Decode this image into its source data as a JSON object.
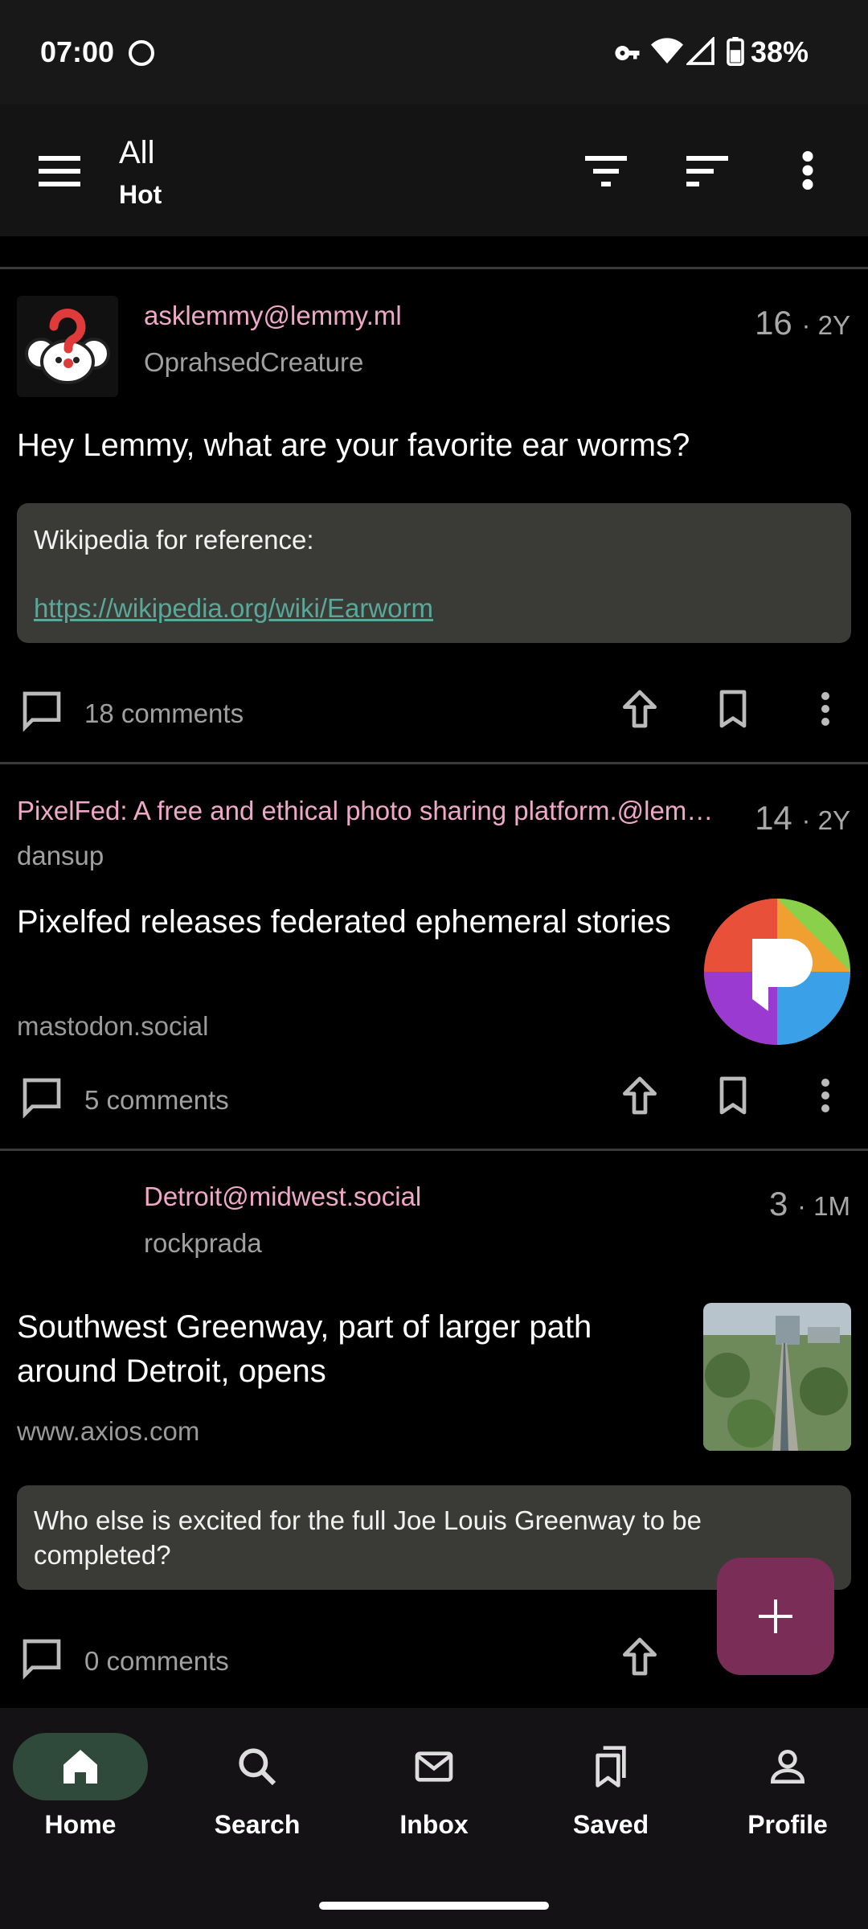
{
  "status_bar": {
    "time": "07:00",
    "battery": "38%"
  },
  "header": {
    "title": "All",
    "subtitle": "Hot"
  },
  "posts": [
    {
      "community": "asklemmy@lemmy.ml",
      "author": "OprahsedCreature",
      "score": "16",
      "age": "· 2Y",
      "title": "Hey Lemmy, what are your favorite ear worms?",
      "body_text": "Wikipedia for reference:",
      "body_link": "https://wikipedia.org/wiki/Earworm",
      "comments": "18 comments"
    },
    {
      "community": "PixelFed: A free and ethical photo sharing platform.@lem…",
      "author": "dansup",
      "score": "14",
      "age": "· 2Y",
      "title": "Pixelfed releases federated ephemeral stories",
      "domain": "mastodon.social",
      "comments": "5 comments"
    },
    {
      "community": "Detroit@midwest.social",
      "author": "rockprada",
      "score": "3",
      "age": "· 1M",
      "title": "Southwest Greenway, part of larger path around Detroit, opens",
      "domain": "www.axios.com",
      "body_text": "Who else is excited for the full Joe Louis Greenway to be completed?",
      "comments": "0 comments"
    }
  ],
  "bottom_nav": [
    {
      "label": "Home"
    },
    {
      "label": "Search"
    },
    {
      "label": "Inbox"
    },
    {
      "label": "Saved"
    },
    {
      "label": "Profile"
    }
  ],
  "colors": {
    "accent_pink": "#f0a8c8",
    "fab": "#7a2d56",
    "home_pill": "#2f4a3a",
    "link": "#5aa899"
  },
  "icons": [
    "menu-icon",
    "filter-icon",
    "sort-icon",
    "more-vert-icon",
    "comment-icon",
    "upvote-icon",
    "bookmark-icon",
    "home-icon",
    "search-icon",
    "mail-icon",
    "saved-icon",
    "profile-icon",
    "plus-icon"
  ]
}
